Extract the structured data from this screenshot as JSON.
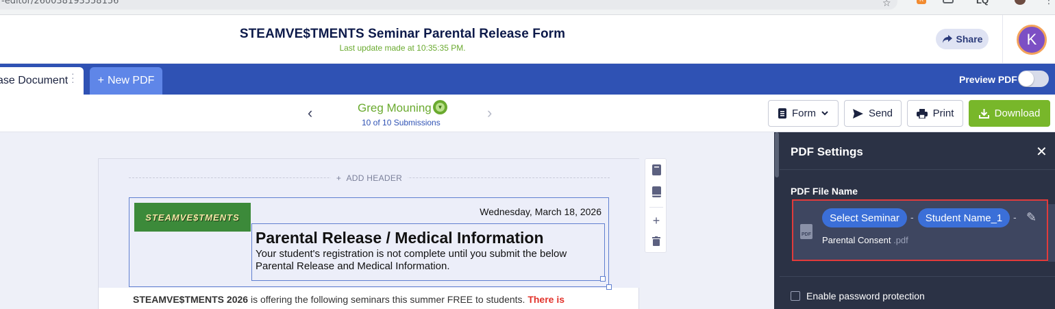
{
  "browser": {
    "url": "-editor/260038193558156",
    "extensions": {
      "lq": "LQ",
      "ext_badge": "K"
    }
  },
  "header": {
    "title": "STEAMVE$TMENTS Seminar Parental Release Form",
    "last_update": "Last update made at 10:35:35 PM.",
    "share_label": "Share",
    "avatar_initial": "K"
  },
  "tabs": {
    "active_label": "ase Document",
    "new_pdf_label": "New PDF",
    "preview_label": "Preview PDF",
    "preview_on": false
  },
  "submission": {
    "name": "Greg Mouning",
    "count": "10 of 10 Submissions"
  },
  "toolbar": {
    "form_label": "Form",
    "send_label": "Send",
    "print_label": "Print",
    "download_label": "Download"
  },
  "document": {
    "add_header": "ADD HEADER",
    "logo_text": "STEAMVE$TMENTS",
    "date": "Wednesday, March 18, 2026",
    "heading": "Parental Release / Medical Information",
    "subtext": "Your student's registration is not complete until you submit the below Parental Release and Medical Information.",
    "body_bold": "STEAMVE$TMENTS 2026",
    "body_text": " is offering the following seminars this summer FREE to students.  ",
    "body_red": "There is"
  },
  "pdf_settings": {
    "title": "PDF Settings",
    "file_name_label": "PDF File Name",
    "chip1": "Select Seminar",
    "chip2": "Student Name_1",
    "separator": "-",
    "static_name": "Parental Consent",
    "ext": ".pdf",
    "password_label": "Enable password protection"
  },
  "colors": {
    "brand_blue": "#2f52b4",
    "download_green": "#78b72a",
    "panel_dark": "#2b3245",
    "chip_blue": "#3b6fd8",
    "highlight_red": "#e23b3b"
  }
}
